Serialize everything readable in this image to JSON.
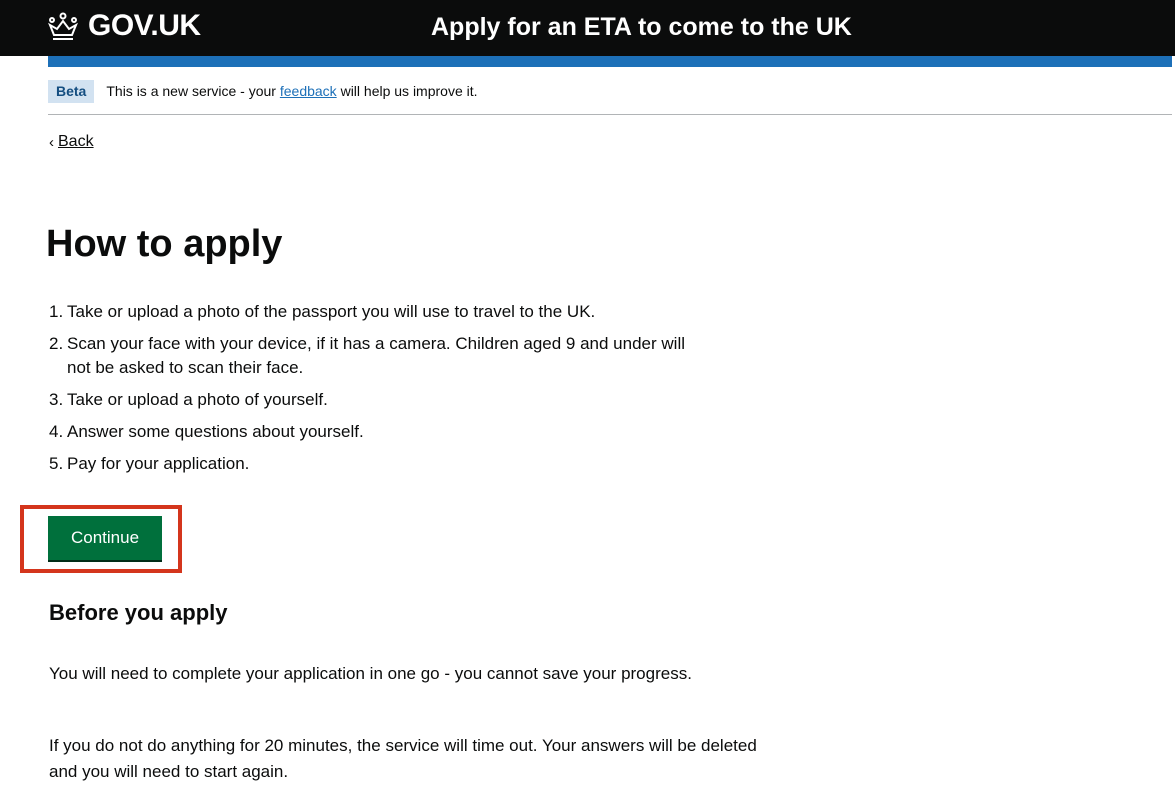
{
  "header": {
    "logo_text": "GOV.UK",
    "service_name": "Apply for an ETA to come to the UK"
  },
  "phase_banner": {
    "tag": "Beta",
    "text_before": "This is a new service - your ",
    "link_text": "feedback",
    "text_after": " will help us improve it."
  },
  "back_link": {
    "label": "Back"
  },
  "main": {
    "title": "How to apply",
    "steps": [
      {
        "number": "1.",
        "text": "Take or upload a photo of the passport you will use to travel to the UK."
      },
      {
        "number": "2.",
        "text": "Scan your face with your device, if it has a camera. Children aged 9 and under will not be asked to scan their face."
      },
      {
        "number": "3.",
        "text": "Take or upload a photo of yourself."
      },
      {
        "number": "4.",
        "text": "Answer some questions about yourself."
      },
      {
        "number": "5.",
        "text": "Pay for your application."
      }
    ],
    "continue_label": "Continue",
    "before_heading": "Before you apply",
    "paragraphs": [
      "You will need to complete your application in one go - you cannot save your progress.",
      "If you do not do anything for 20 minutes, the service will time out. Your answers will be deleted and you will need to start again."
    ]
  },
  "colors": {
    "header_bg": "#0b0c0c",
    "brand_blue": "#1d70b8",
    "button_green": "#00703c",
    "highlight_red": "#d4351c"
  },
  "icons": {
    "logo": "crown-icon",
    "back": "chevron-left-icon"
  }
}
